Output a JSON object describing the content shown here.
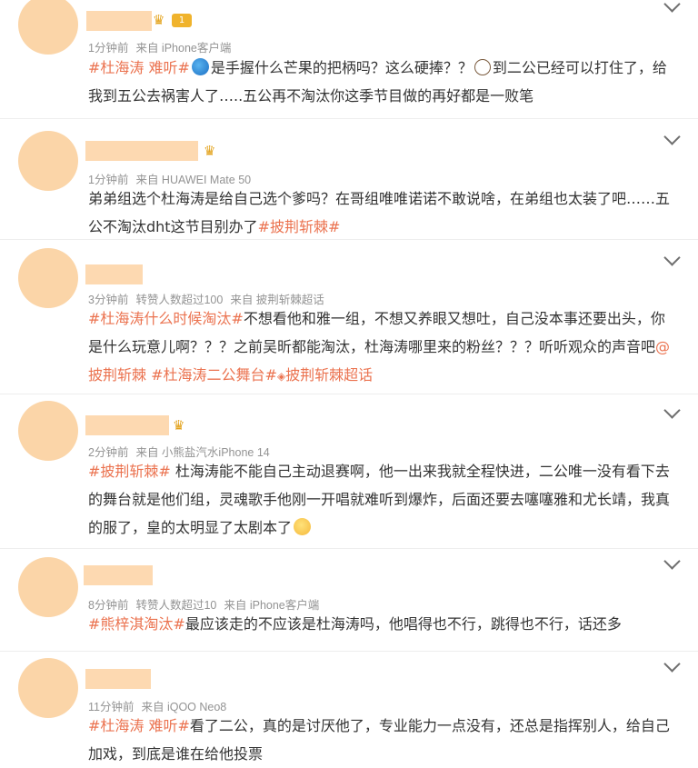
{
  "comments": [
    {
      "meta_time": "1分钟前",
      "meta_extra": "",
      "meta_source": "来自 iPhone客户端",
      "level_badge": "1",
      "segments": [
        {
          "type": "tag",
          "text": "#杜海涛 难听#"
        },
        {
          "type": "emoji",
          "name": "wave-emoji"
        },
        {
          "type": "text",
          "text": "是手握什么芒果的把柄吗？这么硬捧？？"
        },
        {
          "type": "emoji",
          "name": "face-emoji"
        },
        {
          "type": "text",
          "text": "到二公已经可以打住了，给我到五公去祸害人了…..五公再不淘汰你这季节目做的再好都是一败笔"
        }
      ]
    },
    {
      "meta_time": "1分钟前",
      "meta_extra": "",
      "meta_source": "来自 HUAWEI Mate 50",
      "segments": [
        {
          "type": "text",
          "text": "弟弟组选个杜海涛是给自己选个爹吗？在哥组唯唯诺诺不敢说啥，在弟组也太装了吧……五公不淘汰dht这节目别办了"
        },
        {
          "type": "tag",
          "text": "#披荆斩棘#"
        }
      ]
    },
    {
      "meta_time": "3分钟前",
      "meta_extra": "转赞人数超过100",
      "meta_source": "来自 披荆斩棘超话",
      "segments": [
        {
          "type": "tag",
          "text": "#杜海涛什么时候淘汰#"
        },
        {
          "type": "text",
          "text": "不想看他和雅一组，不想又养眼又想吐，自己没本事还要出头，你是什么玩意儿啊？？？之前吴昕都能淘汰，杜海涛哪里来的粉丝？？？听听观众的声音吧"
        },
        {
          "type": "tag",
          "text": "@披荆斩棘"
        },
        {
          "type": "text",
          "text": " "
        },
        {
          "type": "tag",
          "text": "#杜海涛二公舞台#"
        },
        {
          "type": "chao",
          "text": "披荆斩棘超话"
        }
      ]
    },
    {
      "meta_time": "2分钟前",
      "meta_extra": "",
      "meta_source": "来自 小熊盐汽水iPhone 14",
      "segments": [
        {
          "type": "tag",
          "text": "#披荆斩棘#"
        },
        {
          "type": "text",
          "text": " 杜海涛能不能自己主动退赛啊，他一出来我就全程快进，二公唯一没有看下去的舞台就是他们组，灵魂歌手他刚一开唱就难听到爆炸，后面还要去噻噻雅和尤长靖，我真的服了，皇的太明显了太剧本了"
        },
        {
          "type": "emoji",
          "name": "smile-emoji"
        }
      ]
    },
    {
      "meta_time": "8分钟前",
      "meta_extra": "转赞人数超过10",
      "meta_source": "来自 iPhone客户端",
      "segments": [
        {
          "type": "tag",
          "text": "#熊梓淇淘汰#"
        },
        {
          "type": "text",
          "text": "最应该走的不应该是杜海涛吗，他唱得也不行，跳得也不行，话还多"
        }
      ]
    },
    {
      "meta_time": "11分钟前",
      "meta_extra": "",
      "meta_source": "来自 iQOO Neo8",
      "segments": [
        {
          "type": "tag",
          "text": "#杜海涛 难听#"
        },
        {
          "type": "text",
          "text": "看了二公，真的是讨厌他了，专业能力一点没有，还总是指挥别人，给自己加戏，到底是谁在给他投票"
        }
      ]
    }
  ],
  "colors": {
    "tag": "#eb7350",
    "avatar": "#fbd5a8",
    "name_box": "#fdd9b1",
    "meta": "#939393"
  }
}
